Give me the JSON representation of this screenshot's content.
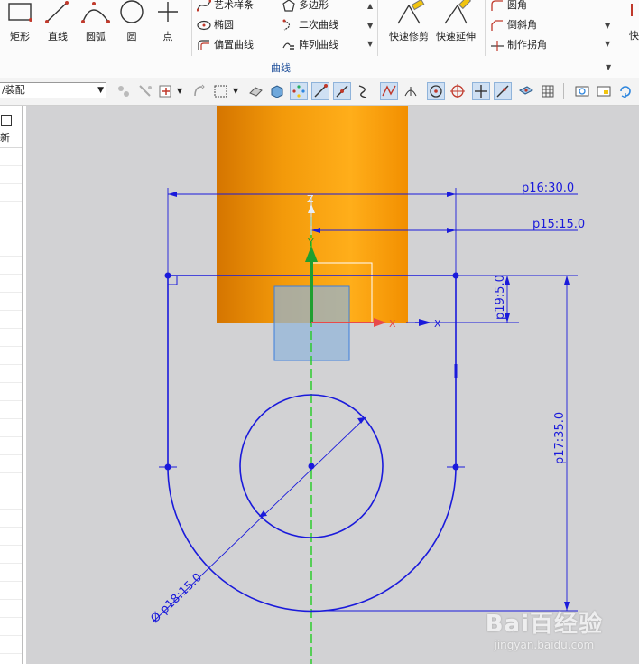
{
  "ribbon": {
    "big_buttons": [
      {
        "name": "rectangle",
        "label": "矩形"
      },
      {
        "name": "line",
        "label": "直线"
      },
      {
        "name": "arc",
        "label": "圆弧"
      },
      {
        "name": "circle",
        "label": "圆"
      },
      {
        "name": "point",
        "label": "点"
      }
    ],
    "small_buttons_col1": [
      "艺术样条",
      "椭圆",
      "偏置曲线"
    ],
    "small_buttons_col2": [
      "多边形",
      "二次曲线",
      "阵列曲线"
    ],
    "trim_buttons": [
      "快速修剪",
      "快速延伸"
    ],
    "corner_buttons": [
      "圆角",
      "倒斜角",
      "制作拐角"
    ],
    "group_label": "曲线",
    "right_cut_label": "快"
  },
  "toolbar": {
    "selection_filter": "/装配"
  },
  "left_panel": {
    "header": "新"
  },
  "sketch": {
    "dimensions": {
      "p16": "p16:30.0",
      "p15": "p15:15.0",
      "p19": "p19:5.0",
      "p17": "p17:35.0",
      "p18": "Ø p18:15.0"
    },
    "axes": {
      "z": "Z",
      "y": "Y",
      "x1": "X",
      "x2": "X"
    }
  },
  "colors": {
    "sketch_blue": "#1a1adb",
    "cylinder_orange": "#f39a0a",
    "axis_green": "#22cc22",
    "background": "#d2d2d4"
  },
  "watermark": {
    "main": "Bai百经验",
    "sub": "jingyan.baidu.com"
  }
}
